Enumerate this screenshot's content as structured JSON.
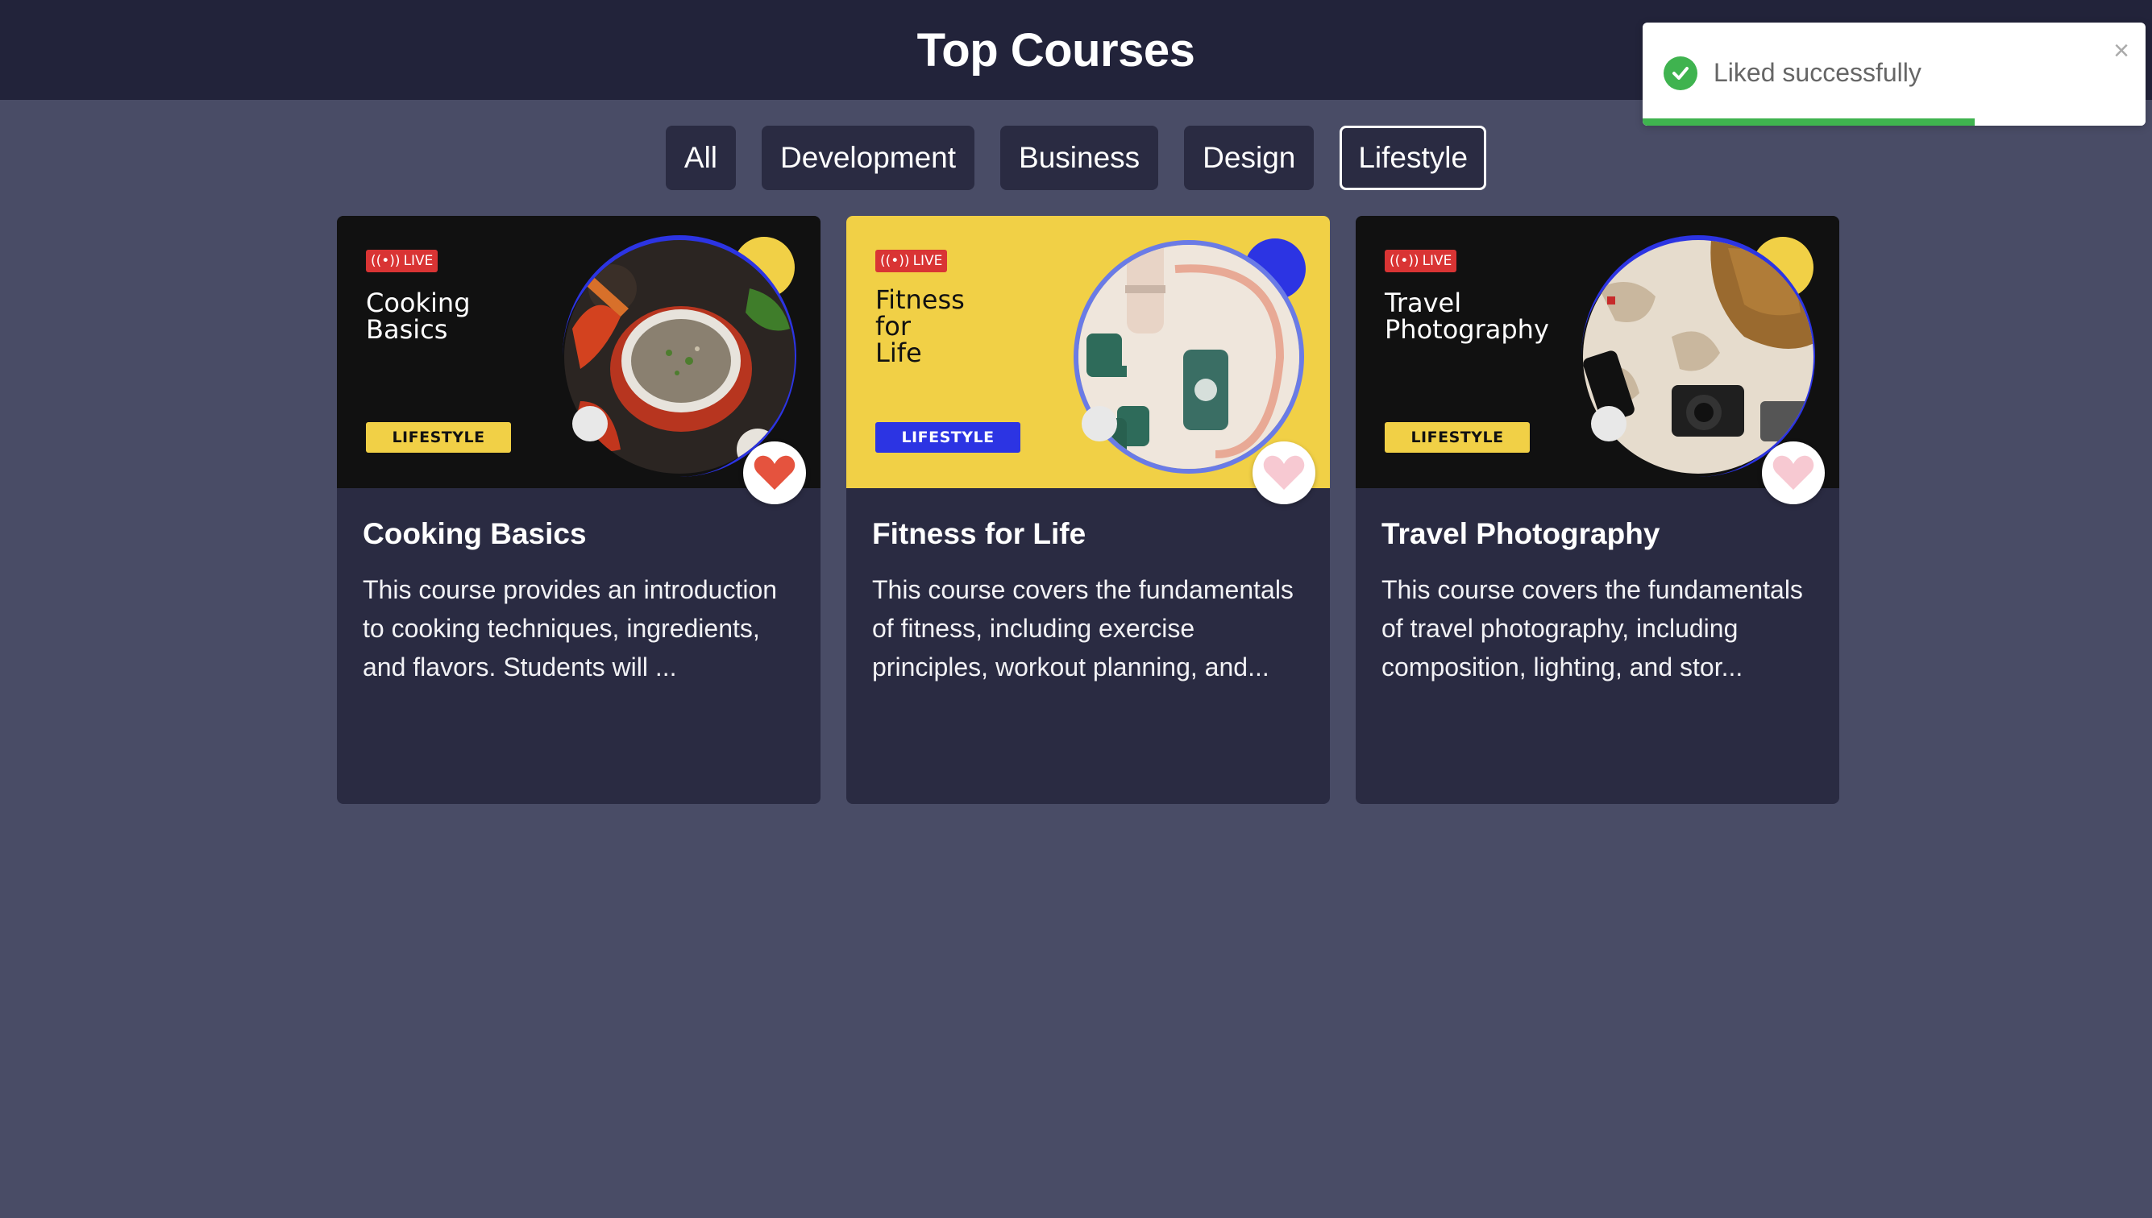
{
  "header": {
    "title": "Top Courses"
  },
  "filters": [
    {
      "label": "All",
      "active": false
    },
    {
      "label": "Development",
      "active": false
    },
    {
      "label": "Business",
      "active": false
    },
    {
      "label": "Design",
      "active": false
    },
    {
      "label": "Lifestyle",
      "active": true
    }
  ],
  "courses": [
    {
      "thumb_live": "LIVE",
      "thumb_title": "Cooking\nBasics",
      "thumb_category": "LIFESTYLE",
      "title": "Cooking Basics",
      "description": "This course provides an introduction to cooking techniques, ingredients, and flavors. Students will ...",
      "liked": true
    },
    {
      "thumb_live": "LIVE",
      "thumb_title": "Fitness\nfor\nLife",
      "thumb_category": "LIFESTYLE",
      "title": "Fitness for Life",
      "description": "This course covers the fundamentals of fitness, including exercise principles, workout planning, and...",
      "liked": false
    },
    {
      "thumb_live": "LIVE",
      "thumb_title": "Travel\nPhotography",
      "thumb_category": "LIFESTYLE",
      "title": "Travel Photography",
      "description": "This course covers the fundamentals of travel photography, including composition, lighting, and stor...",
      "liked": false
    }
  ],
  "toast": {
    "message": "Liked successfully",
    "close": "×",
    "icon": "check-circle-icon",
    "progress": 0.66
  },
  "colors": {
    "background": "#494c66",
    "header": "#22233a",
    "card": "#2a2b42",
    "liked_heart": "#e5533e",
    "unliked_heart": "#f7c9d2",
    "success": "#3fb34f",
    "accent_yellow": "#f1d046",
    "accent_blue": "#2c34e3",
    "live_red": "#d93434"
  }
}
